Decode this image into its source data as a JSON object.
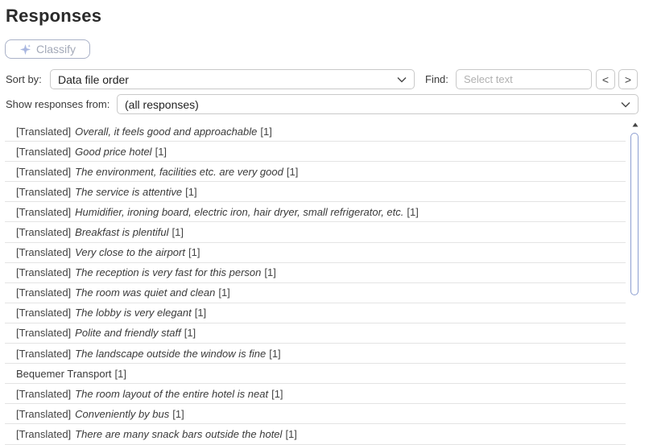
{
  "panel": {
    "title": "Responses"
  },
  "toolbar": {
    "classify_label": "Classify"
  },
  "sort": {
    "label": "Sort by:",
    "value": "Data file order"
  },
  "find": {
    "label": "Find:",
    "placeholder": "Select text",
    "prev_label": "<",
    "next_label": ">"
  },
  "filter": {
    "label": "Show responses from:",
    "value": "(all responses)"
  },
  "responses": [
    {
      "tag": "[Translated]",
      "text": "Overall, it feels good and approachable",
      "count": "[1]"
    },
    {
      "tag": "[Translated]",
      "text": "Good price hotel",
      "count": "[1]"
    },
    {
      "tag": "[Translated]",
      "text": "The environment, facilities etc. are very good",
      "count": "[1]"
    },
    {
      "tag": "[Translated]",
      "text": "The service is attentive",
      "count": "[1]"
    },
    {
      "tag": "[Translated]",
      "text": "Humidifier, ironing board, electric iron, hair dryer, small refrigerator, etc.",
      "count": "[1]"
    },
    {
      "tag": "[Translated]",
      "text": "Breakfast is plentiful",
      "count": "[1]"
    },
    {
      "tag": "[Translated]",
      "text": "Very close to the airport",
      "count": "[1]"
    },
    {
      "tag": "[Translated]",
      "text": "The reception is very fast for this person",
      "count": "[1]"
    },
    {
      "tag": "[Translated]",
      "text": "The room was quiet and clean",
      "count": "[1]"
    },
    {
      "tag": "[Translated]",
      "text": "The lobby is very elegant",
      "count": "[1]"
    },
    {
      "tag": "[Translated]",
      "text": "Polite and friendly staff",
      "count": "[1]"
    },
    {
      "tag": "[Translated]",
      "text": "The landscape outside the window is fine",
      "count": "[1]"
    },
    {
      "tag": "",
      "text": "Bequemer Transport",
      "count": "[1]"
    },
    {
      "tag": "[Translated]",
      "text": "The room layout of the entire hotel is neat",
      "count": "[1]"
    },
    {
      "tag": "[Translated]",
      "text": "Conveniently by bus",
      "count": "[1]"
    },
    {
      "tag": "[Translated]",
      "text": "There are many snack bars outside the hotel",
      "count": "[1]"
    }
  ],
  "colors": {
    "accent": "#8d9fd1",
    "classify_disabled": "#a3a9b8",
    "divider": "#e4e4e4"
  }
}
